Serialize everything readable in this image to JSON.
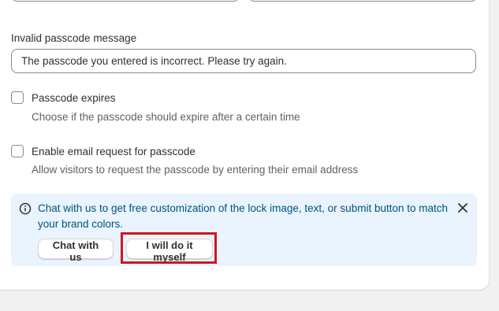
{
  "invalid_message": {
    "label": "Invalid passcode message",
    "value": "The passcode you entered is incorrect. Please try again."
  },
  "expires": {
    "label": "Passcode expires",
    "help": "Choose if the passcode should expire after a certain time",
    "checked": false
  },
  "email_request": {
    "label": "Enable email request for passcode",
    "help": "Allow visitors to request the passcode by entering their email address",
    "checked": false
  },
  "banner": {
    "text": "Chat with us to get free customization of the lock image, text, or submit button to match your brand colors.",
    "chat_button": "Chat with us",
    "self_button": "I will do it myself",
    "icon": "info-icon",
    "close_icon": "close-icon",
    "highlight_color": "#d0161e"
  }
}
